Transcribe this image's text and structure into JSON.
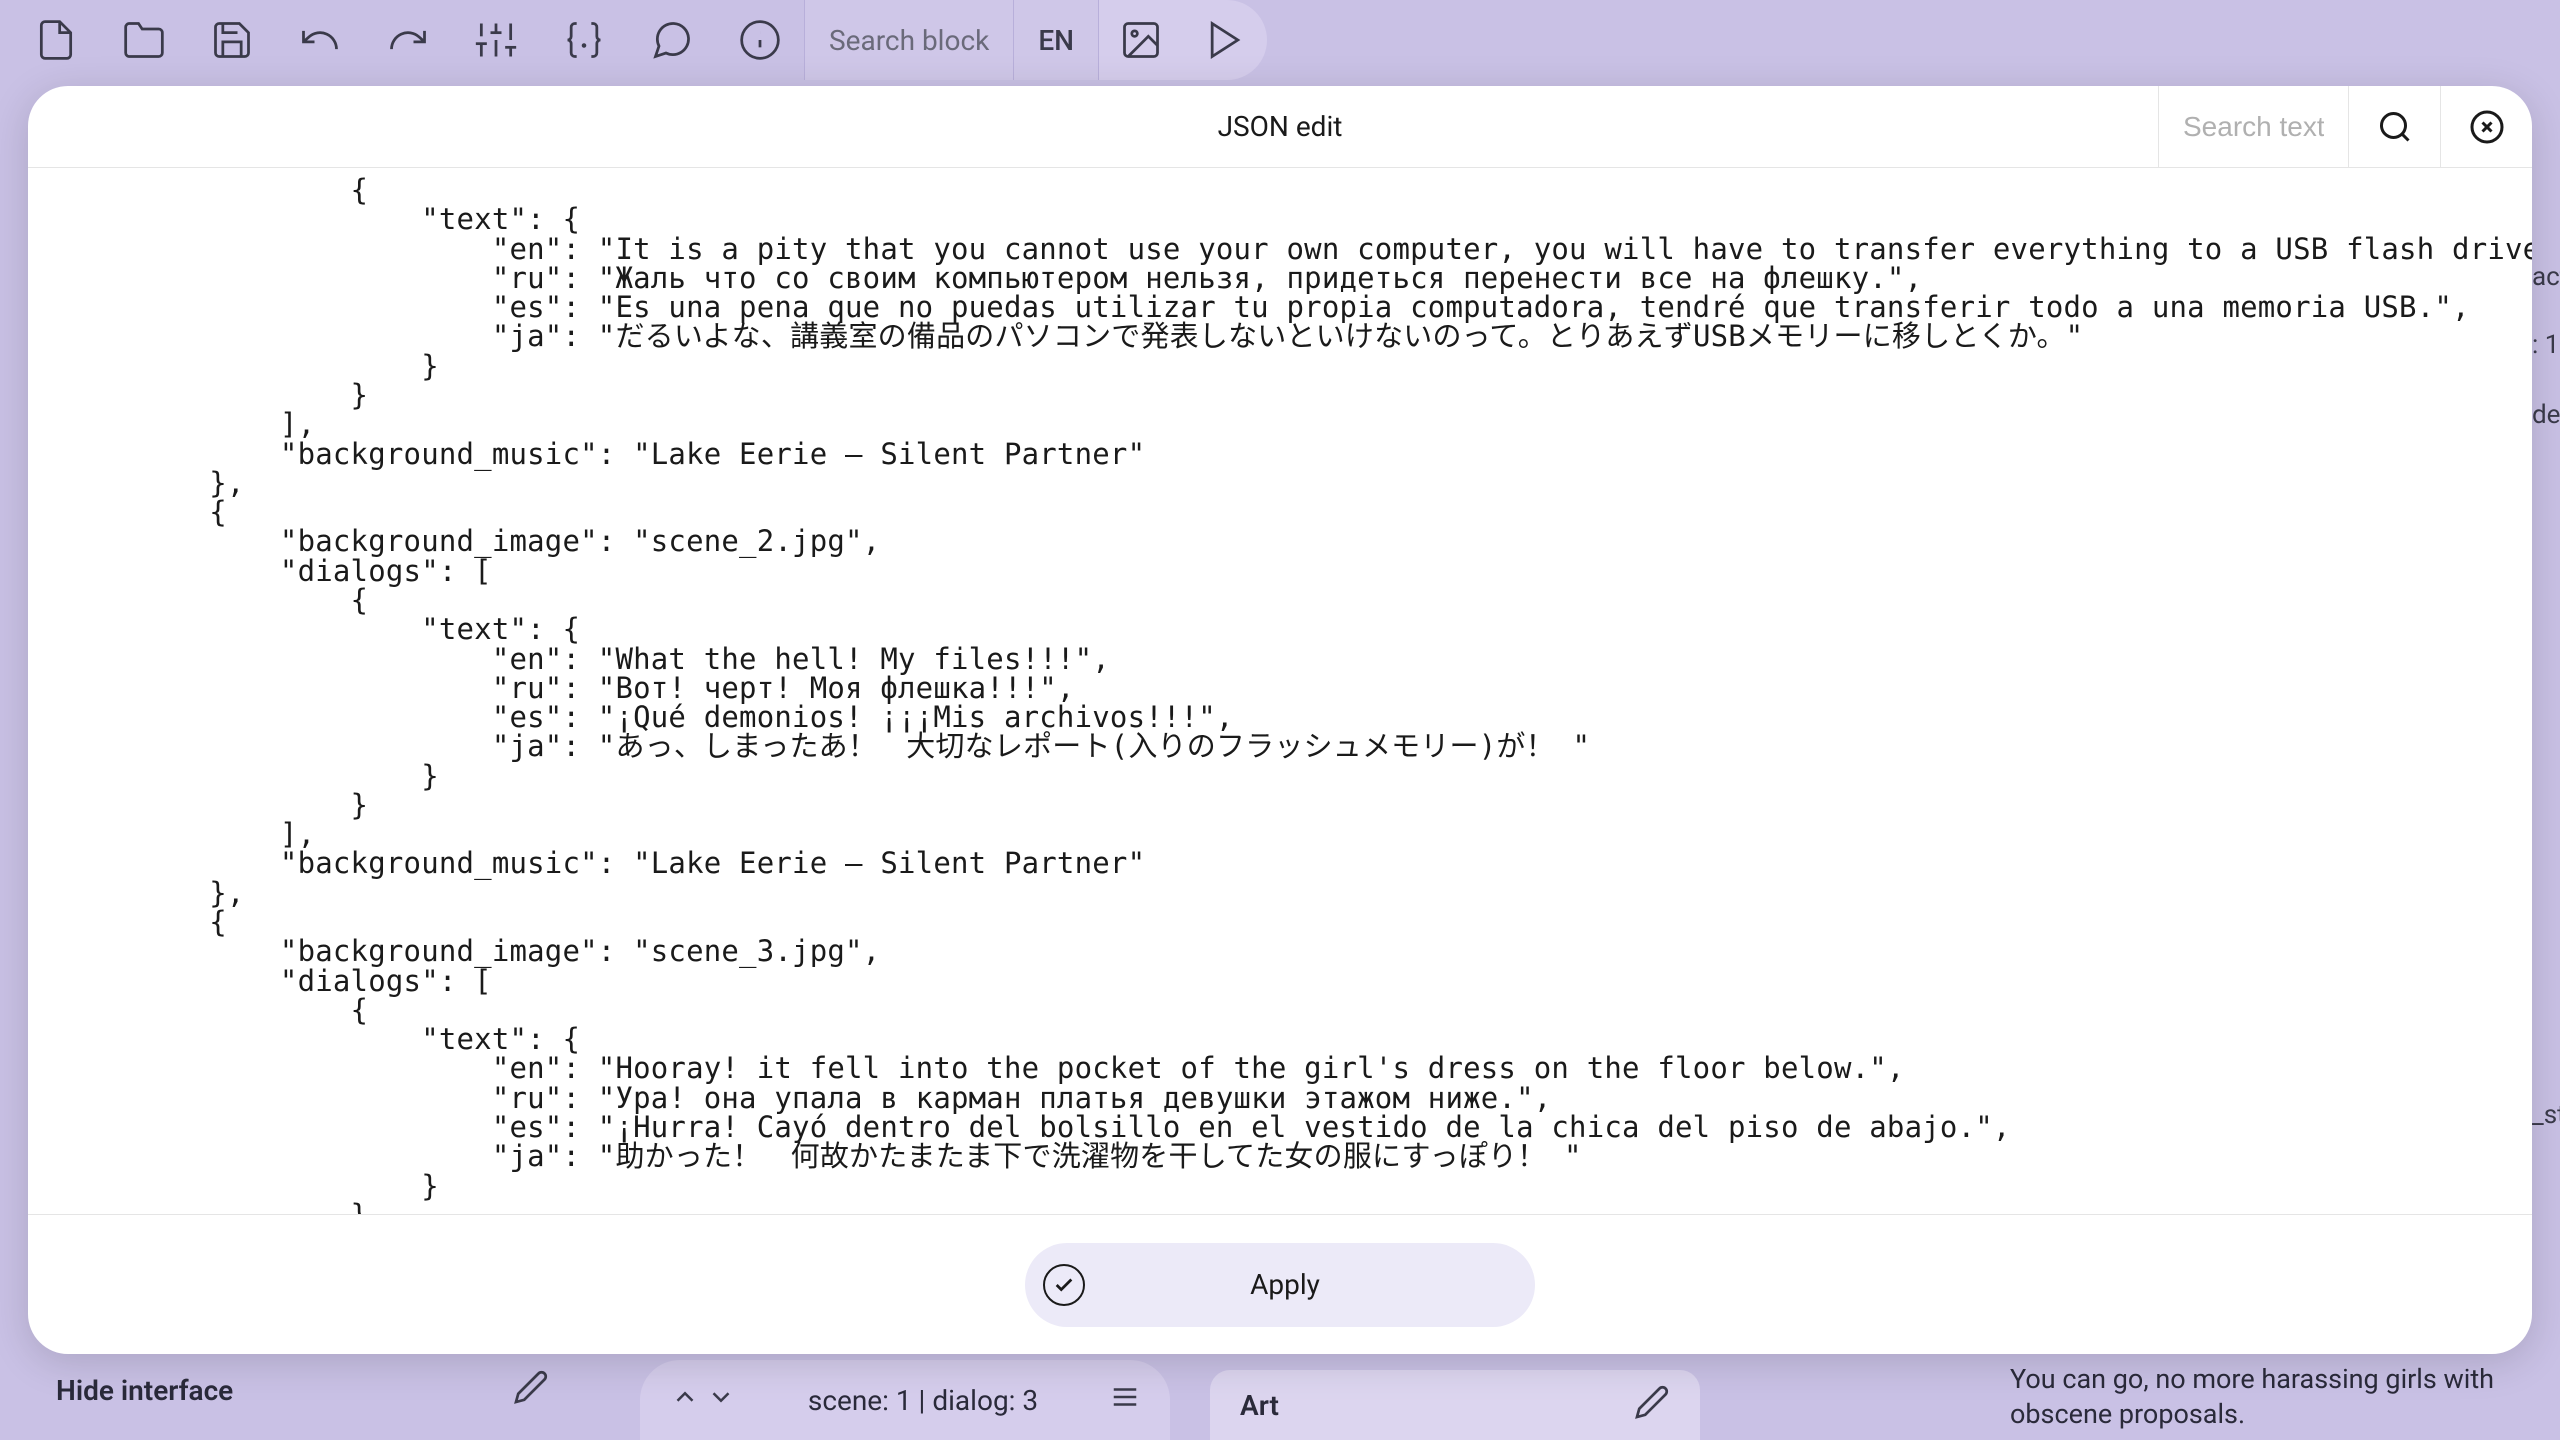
{
  "toolbar": {
    "search_block_placeholder": "Search block",
    "lang": "EN"
  },
  "modal": {
    "title": "JSON edit",
    "search_placeholder": "Search text",
    "apply_label": "Apply",
    "code": "                {\n                    \"text\": {\n                        \"en\": \"It is a pity that you cannot use your own computer, you will have to transfer everything to a USB flash drive.\",\n                        \"ru\": \"Жаль что со своим компьютером нельзя, придеться перенести все на флешку.\",\n                        \"es\": \"Es una pena que no puedas utilizar tu propia computadora, tendré que transferir todo a una memoria USB.\",\n                        \"ja\": \"だるいよな、講義室の備品のパソコンで発表しないといけないのって。とりあえずUSBメモリーに移しとくか。\"\n                    }\n                }\n            ],\n            \"background_music\": \"Lake Eerie – Silent Partner\"\n        },\n        {\n            \"background_image\": \"scene_2.jpg\",\n            \"dialogs\": [\n                {\n                    \"text\": {\n                        \"en\": \"What the hell! My files!!!\",\n                        \"ru\": \"Вот! черт! Моя флешка!!!\",\n                        \"es\": \"¡Qué demonios! ¡¡¡Mis archivos!!!\",\n                        \"ja\": \"あっ、しまったあ！　大切なレポート(入りのフラッシュメモリー)が！ \"\n                    }\n                }\n            ],\n            \"background_music\": \"Lake Eerie – Silent Partner\"\n        },\n        {\n            \"background_image\": \"scene_3.jpg\",\n            \"dialogs\": [\n                {\n                    \"text\": {\n                        \"en\": \"Hooray! it fell into the pocket of the girl's dress on the floor below.\",\n                        \"ru\": \"Ура! она упала в карман платья девушки этажом ниже.\",\n                        \"es\": \"¡Hurra! Cayó dentro del bolsillo en el vestido de la chica del piso de abajo.\",\n                        \"ja\": \"助かった！　何故かたまたま下で洗濯物を干してた女の服にすっぽり！ \"\n                    }\n                }\n            ],"
  },
  "background": {
    "hide_interface": "Hide interface",
    "scene_dialog": "scene: 1 | dialog: 3",
    "art_label": "Art",
    "right_text": "You can go, no more harassing girls with obscene proposals.",
    "frag1": "actio",
    "frag2": ": 1",
    "frag3": "de",
    "frag4": "_sta"
  }
}
